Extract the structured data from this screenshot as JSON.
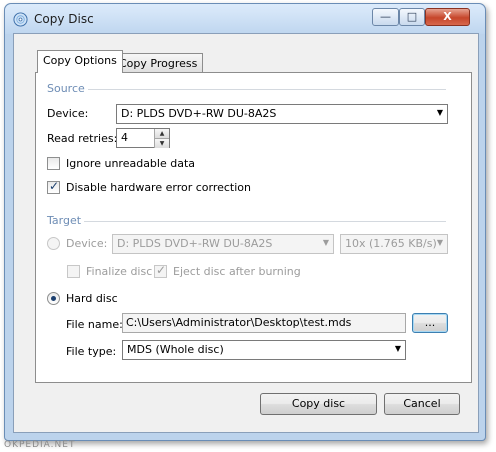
{
  "window": {
    "title": "Copy Disc",
    "icon": "disc-icon"
  },
  "titlebar_buttons": {
    "minimize": "—",
    "maximize": "□",
    "close": "X"
  },
  "tabs": [
    {
      "label": "Copy Options",
      "active": true
    },
    {
      "label": "Copy Progress",
      "active": false
    }
  ],
  "source": {
    "group_label": "Source",
    "device_label": "Device:",
    "device_value": "D: PLDS DVD+-RW DU-8A2S",
    "read_retries_label": "Read retries:",
    "read_retries_value": "4",
    "ignore_unreadable_label": "Ignore unreadable data",
    "ignore_unreadable_checked": false,
    "disable_hw_label": "Disable hardware error correction",
    "disable_hw_checked": true
  },
  "target": {
    "group_label": "Target",
    "device_label": "Device:",
    "device_value": "D: PLDS DVD+-RW DU-8A2S",
    "speed_value": "10x (1.765 KB/s)",
    "finalize_label": "Finalize disc",
    "finalize_checked": false,
    "eject_label": "Eject disc after burning",
    "eject_checked": true,
    "hard_disc_label": "Hard disc",
    "hard_disc_selected": true,
    "file_name_label": "File name:",
    "file_name_value": "C:\\Users\\Administrator\\Desktop\\test.mds",
    "browse_label": "...",
    "file_type_label": "File type:",
    "file_type_value": "MDS (Whole disc)"
  },
  "buttons": {
    "copy": "Copy disc",
    "cancel": "Cancel"
  },
  "watermark": "OKPEDIA.NET",
  "colors": {
    "group_label": "#6e8db5",
    "accent": "#1c3f6e",
    "disabled_text": "#9c9c9c"
  }
}
